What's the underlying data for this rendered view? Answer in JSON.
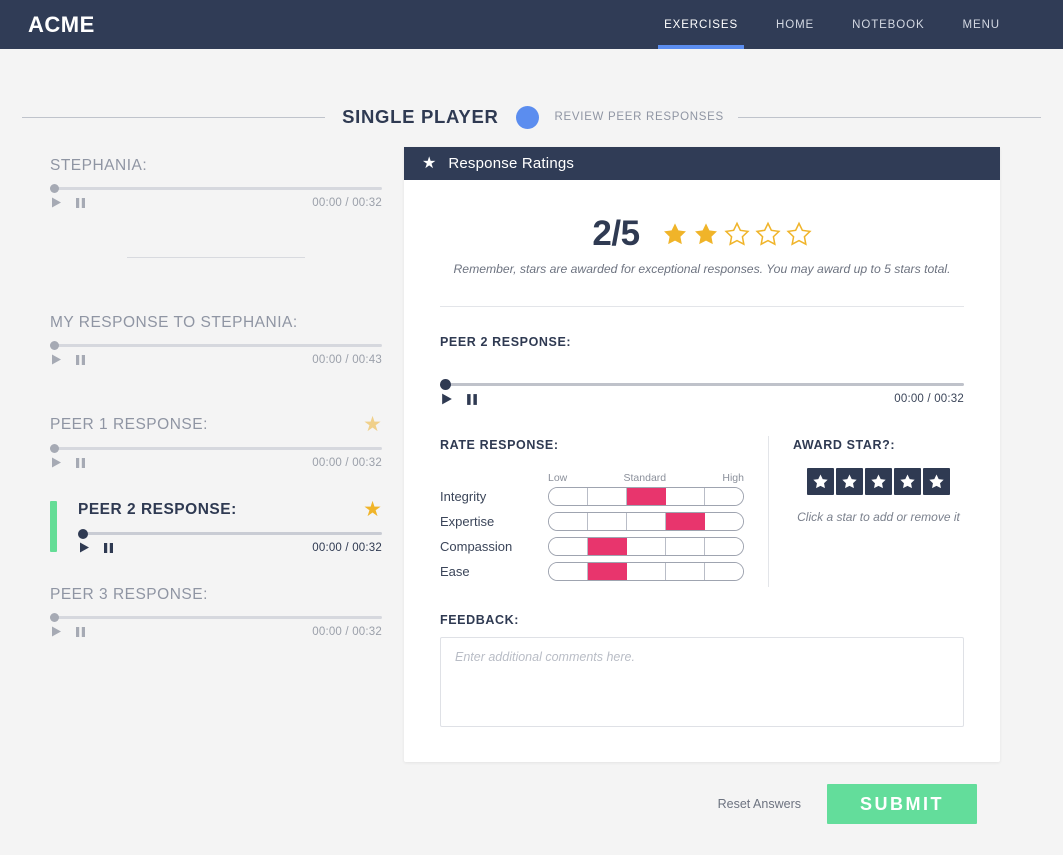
{
  "header": {
    "brand": "ACME",
    "nav": [
      {
        "label": "EXERCISES",
        "active": true
      },
      {
        "label": "HOME",
        "active": false
      },
      {
        "label": "NOTEBOOK",
        "active": false
      },
      {
        "label": "MENU",
        "active": false
      }
    ],
    "accent_color": "#5b8def",
    "bar_color": "#303c56"
  },
  "stepper": {
    "current_label": "SINGLE PLAYER",
    "next_label": "REVIEW PEER RESPONSES",
    "dot_color": "#5b8def"
  },
  "sidebar": {
    "tracks": [
      {
        "title": "STEPHANIA:",
        "time": "00:00 / 00:32",
        "star": null,
        "active": false
      },
      {
        "title": "MY RESPONSE TO STEPHANIA:",
        "time": "00:00 / 00:43",
        "star": null,
        "active": false
      },
      {
        "title": "PEER 1 RESPONSE:",
        "time": "00:00 / 00:32",
        "star": "awarded-faded",
        "active": false
      },
      {
        "title": "PEER 2 RESPONSE:",
        "time": "00:00 / 00:32",
        "star": "awarded",
        "active": true
      },
      {
        "title": "PEER 3 RESPONSE:",
        "time": "00:00 / 00:32",
        "star": null,
        "active": false
      }
    ],
    "active_marker_color": "#64dd96"
  },
  "panel": {
    "header_title": "Response Ratings",
    "header_icon": "star-icon",
    "score_text": "2/5",
    "stars_filled": 2,
    "stars_total": 5,
    "star_color": "#f0b429",
    "hint": "Remember, stars are awarded for exceptional responses. You may award up to 5 stars total.",
    "player": {
      "label": "PEER 2 RESPONSE:",
      "time": "00:00 / 00:32"
    },
    "rate": {
      "label": "RATE RESPONSE:",
      "scale_marks": [
        "Low",
        "Standard",
        "High"
      ],
      "segments": 5,
      "fill_color": "#e8356d",
      "criteria": [
        {
          "name": "Integrity",
          "value": 3
        },
        {
          "name": "Expertise",
          "value": 4
        },
        {
          "name": "Compassion",
          "value": 2
        },
        {
          "name": "Ease",
          "value": 2
        }
      ]
    },
    "award": {
      "label": "AWARD STAR?:",
      "count": 5,
      "hint": "Click a star to add or remove it"
    },
    "feedback": {
      "label": "FEEDBACK:",
      "placeholder": "Enter additional comments here.",
      "value": ""
    }
  },
  "footer": {
    "reset_label": "Reset Answers",
    "submit_label": "SUBMIT",
    "submit_color": "#63dd9b"
  }
}
